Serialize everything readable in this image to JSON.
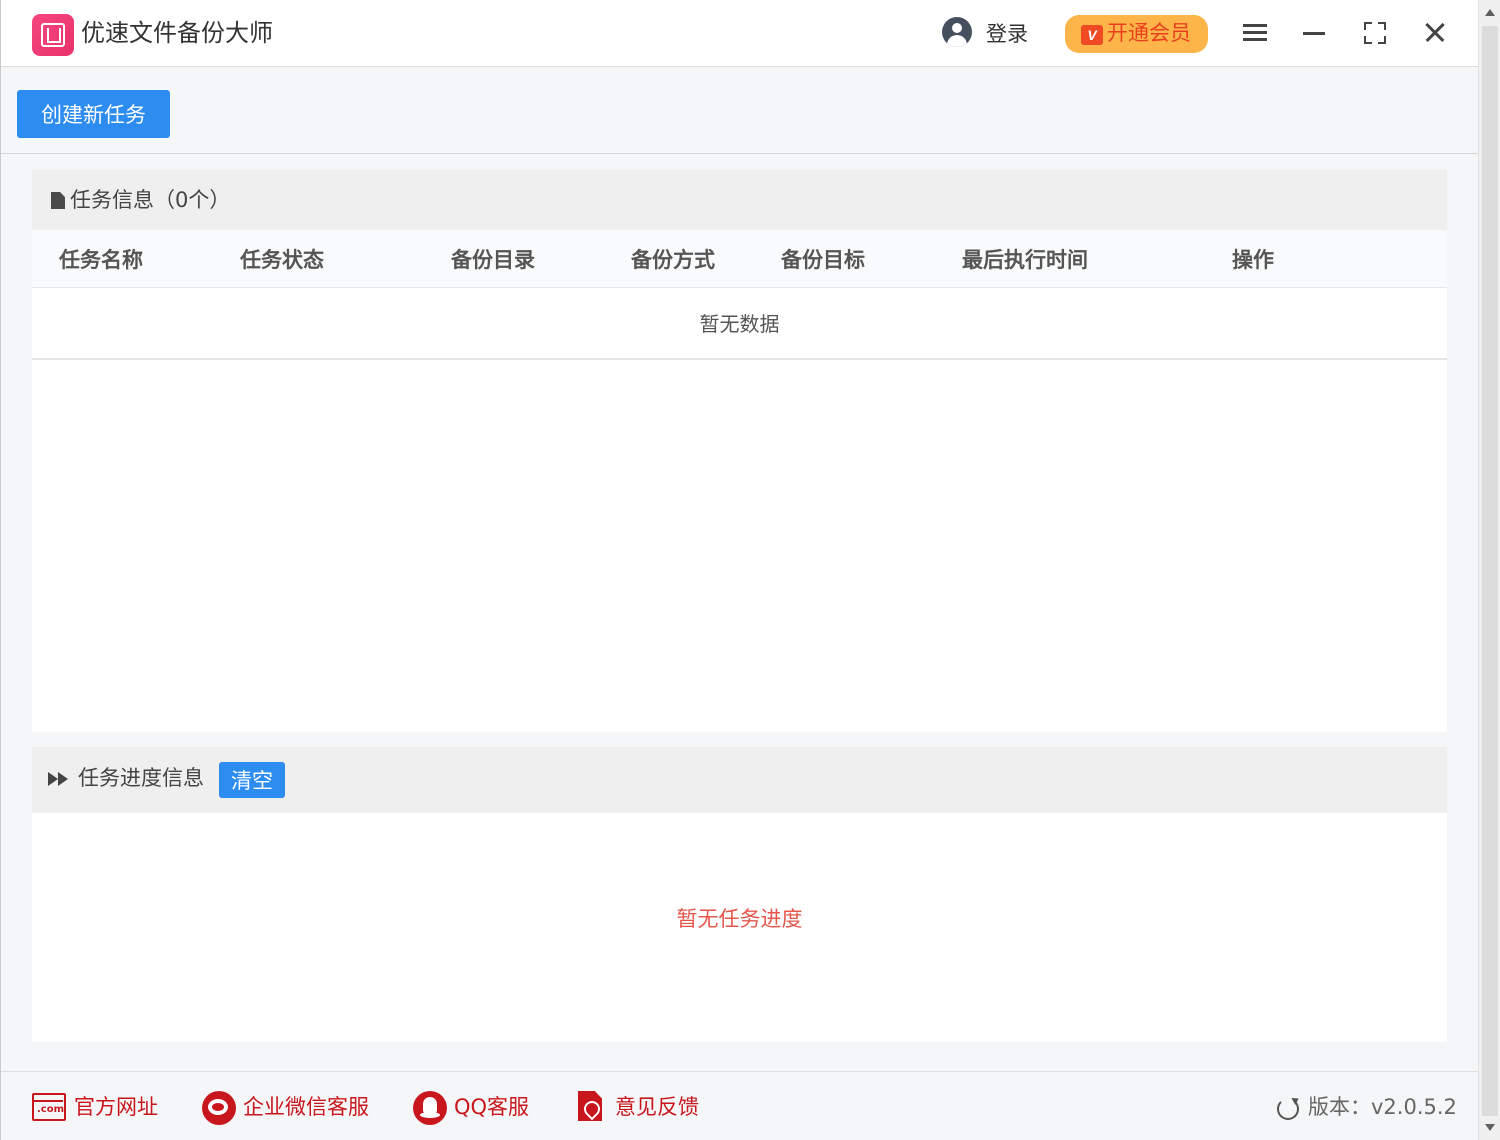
{
  "app": {
    "title": "优速文件备份大师"
  },
  "header": {
    "login_label": "登录",
    "vip_label": "开通会员",
    "vip_icon_text": "V"
  },
  "toolbar": {
    "create_task_label": "创建新任务"
  },
  "task_info": {
    "title": "任务信息（0个）",
    "columns": [
      "任务名称",
      "任务状态",
      "备份目录",
      "备份方式",
      "备份目标",
      "最后执行时间",
      "操作"
    ],
    "empty_text": "暂无数据"
  },
  "progress": {
    "title": "任务进度信息",
    "clear_label": "清空",
    "empty_text": "暂无任务进度"
  },
  "footer": {
    "links": [
      {
        "label": "官方网址",
        "icon": "website-icon"
      },
      {
        "label": "企业微信客服",
        "icon": "wechat-icon"
      },
      {
        "label": "QQ客服",
        "icon": "qq-icon"
      },
      {
        "label": "意见反馈",
        "icon": "feedback-pdf-icon"
      }
    ],
    "version_label": "版本：v2.0.5.2",
    "web_icon_text": ".com"
  },
  "colors": {
    "primary": "#2d8cf0",
    "vip_bg": "#fdb54a",
    "vip_text": "#e8401e",
    "footer_red": "#c8161d",
    "empty_progress_text": "#e4574c"
  }
}
